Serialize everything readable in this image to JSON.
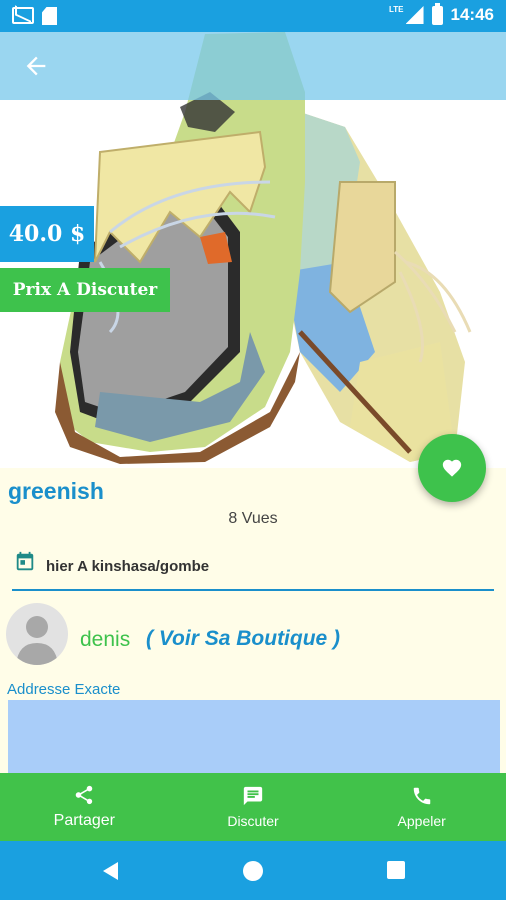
{
  "status_bar": {
    "time": "14:46",
    "network": "LTE"
  },
  "product": {
    "price": "40.0 $",
    "price_note": "Prix A Discuter",
    "title": "greenish",
    "views": "8 Vues",
    "posted": "hier A kinshasa/gombe"
  },
  "seller": {
    "name": "denis",
    "shop_link": "( Voir Sa Boutique )"
  },
  "address": {
    "label": "Addresse Exacte"
  },
  "actions": [
    {
      "label": "Partager",
      "icon": "share-icon"
    },
    {
      "label": "Discuter",
      "icon": "chat-icon"
    },
    {
      "label": "Appeler",
      "icon": "phone-icon"
    }
  ],
  "colors": {
    "primary_blue": "#1aa0e0",
    "accent_green": "#3ec24c",
    "content_bg": "#fffde8",
    "map_blue": "#a9cdf9"
  }
}
